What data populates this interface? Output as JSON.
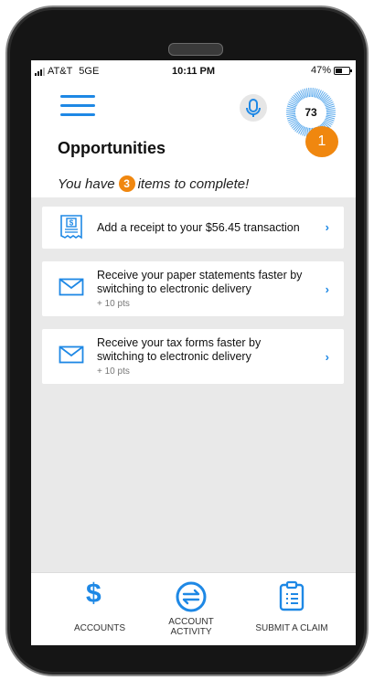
{
  "status_bar": {
    "carrier": "AT&T",
    "network": "5GE",
    "time": "10:11 PM",
    "battery": "47%",
    "battery_level": 0.47
  },
  "header": {
    "menu_icon": "hamburger-menu-icon",
    "mic_icon": "microphone-icon",
    "score": "73",
    "notification_count": "1",
    "title": "Opportunities",
    "subtitle_before": "You have",
    "items_count": "3",
    "subtitle_after": "items to complete!"
  },
  "opportunities": [
    {
      "icon": "receipt-icon",
      "line1": "Add a receipt to your $56.45 transaction",
      "line2": "",
      "points": ""
    },
    {
      "icon": "envelope-icon",
      "line1": "Receive your paper statements faster by",
      "line2": "switching to electronic delivery",
      "points": "+ 10 pts"
    },
    {
      "icon": "envelope-icon",
      "line1": "Receive your tax forms faster by",
      "line2": "switching to electronic delivery",
      "points": "+ 10 pts"
    }
  ],
  "bottom_nav": {
    "accounts": {
      "line1": "ACCOUNTS",
      "icon": "dollar-icon"
    },
    "activity": {
      "line1": "ACCOUNT",
      "line2": "ACTIVITY",
      "icon": "transfer-arrows-icon"
    },
    "claim": {
      "line1": "SUBMIT A CLAIM",
      "icon": "clipboard-icon"
    }
  },
  "colors": {
    "accent": "#1e88e5",
    "badge": "#f0870f",
    "background": "#e9e9e9"
  }
}
